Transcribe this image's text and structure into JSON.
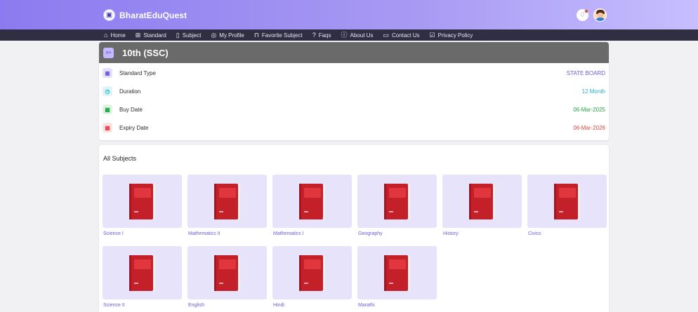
{
  "app": {
    "brand": "BharatEduQuest"
  },
  "nav": [
    {
      "label": "Home",
      "icon": "home-icon",
      "glyph": "⌂"
    },
    {
      "label": "Standard",
      "icon": "grid-icon",
      "glyph": "⊞"
    },
    {
      "label": "Subject",
      "icon": "book-icon",
      "glyph": "▯"
    },
    {
      "label": "My Profile",
      "icon": "user-icon",
      "glyph": "◎"
    },
    {
      "label": "Favorite Subject",
      "icon": "bookmark-icon",
      "glyph": "⊓"
    },
    {
      "label": "Faqs",
      "icon": "question-icon",
      "glyph": "?"
    },
    {
      "label": "About Us",
      "icon": "info-icon",
      "glyph": "ⓘ"
    },
    {
      "label": "Contact Us",
      "icon": "chat-icon",
      "glyph": "▭"
    },
    {
      "label": "Privacy Policy",
      "icon": "shield-check-icon",
      "glyph": "☑"
    }
  ],
  "standard": {
    "title": "10th (SSC)",
    "rows": [
      {
        "label": "Standard Type",
        "value": "STATE BOARD",
        "icon": "standard-type-icon",
        "color": "#6a5cdb",
        "bg": "#e6e2fb",
        "glyph": "▣"
      },
      {
        "label": "Duration",
        "value": "12 Month",
        "icon": "clock-icon",
        "color": "#1fb1c6",
        "bg": "#dff4f7",
        "glyph": "◷"
      },
      {
        "label": "Buy Date",
        "value": "06-Mar-2025",
        "icon": "calendar-icon",
        "color": "#22a544",
        "bg": "#dff4e4",
        "glyph": "▦"
      },
      {
        "label": "Expiry Date",
        "value": "06-Mar-2026",
        "icon": "calendar-expiry-icon",
        "color": "#e04545",
        "bg": "#fde3e3",
        "glyph": "▦"
      }
    ]
  },
  "subjects": {
    "heading": "All Subjects",
    "items": [
      "Science I",
      "Mathematics II",
      "Mathematics I",
      "Geography",
      "History",
      "Civics",
      "Science II",
      "English",
      "Hindi",
      "Marathi"
    ]
  },
  "colors": {
    "accent": "#6a5cdb",
    "nav_bg": "#2f2e42",
    "header_grey": "#6a6a6a",
    "tile_bg": "#e6e3fb",
    "book_red": "#c4202a"
  }
}
